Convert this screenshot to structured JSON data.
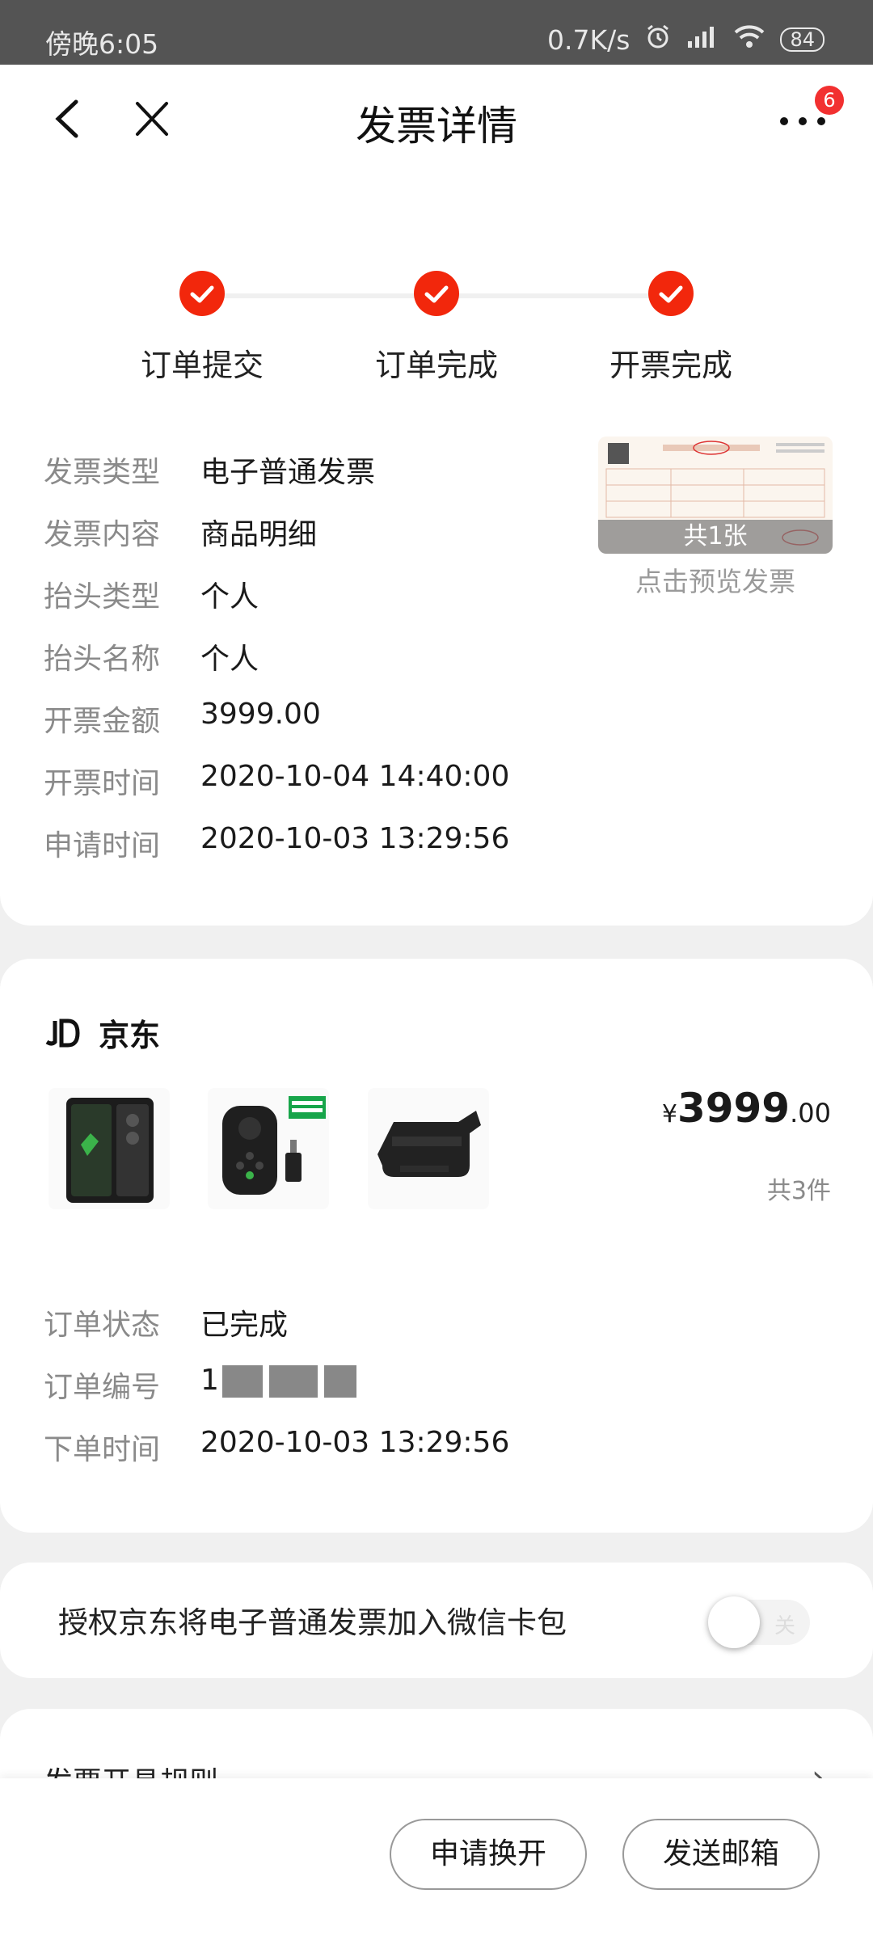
{
  "status_bar": {
    "time": "傍晚6:05",
    "network_speed": "0.7K/s",
    "battery": "84"
  },
  "nav": {
    "title": "发票详情",
    "badge_count": "6"
  },
  "steps": [
    {
      "label": "订单提交"
    },
    {
      "label": "订单完成"
    },
    {
      "label": "开票完成"
    }
  ],
  "invoice": {
    "rows": [
      {
        "key": "发票类型",
        "value": "电子普通发票"
      },
      {
        "key": "发票内容",
        "value": "商品明细"
      },
      {
        "key": "抬头类型",
        "value": "个人"
      },
      {
        "key": "抬头名称",
        "value": "个人"
      },
      {
        "key": "开票金额",
        "value": "3999.00"
      },
      {
        "key": "开票时间",
        "value": "2020-10-04 14:40:00"
      },
      {
        "key": "申请时间",
        "value": "2020-10-03 13:29:56"
      }
    ],
    "preview_count": "共1张",
    "preview_link": "点击预览发票"
  },
  "order": {
    "shop_logo": "JD",
    "shop_name": "京东",
    "price_currency": "¥",
    "price_integer": "3999",
    "price_decimal": ".00",
    "quantity": "共3件",
    "status_key": "订单状态",
    "status_value": "已完成",
    "number_key": "订单编号",
    "number_value_visible": "1",
    "time_key": "下单时间",
    "time_value": "2020-10-03 13:29:56"
  },
  "wechat_card": {
    "text": "授权京东将电子普通发票加入微信卡包",
    "toggle_label": "关",
    "enabled": false
  },
  "rules": {
    "label": "发票开具规则"
  },
  "actions": {
    "reissue": "申请换开",
    "send_email": "发送邮箱"
  },
  "colors": {
    "accent": "#f2270c",
    "badge": "#f23030"
  }
}
